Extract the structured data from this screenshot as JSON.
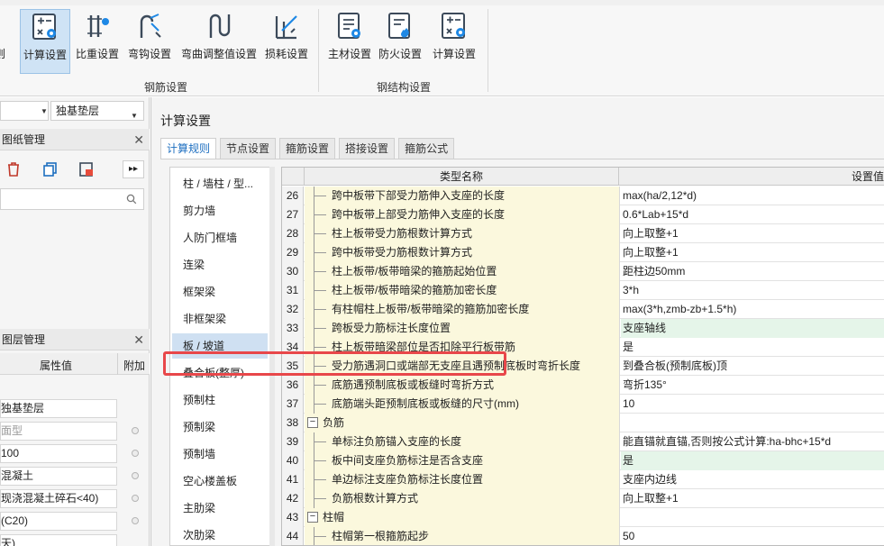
{
  "ribbon": {
    "buttons": [
      {
        "label": "计算设置",
        "icon": "calc-settings-icon",
        "active": true
      },
      {
        "label": "比重设置",
        "icon": "density-icon"
      },
      {
        "label": "弯钩设置",
        "icon": "hook-icon"
      },
      {
        "label": "弯曲调整值设置",
        "icon": "bend-adjust-icon"
      },
      {
        "label": "损耗设置",
        "icon": "loss-icon"
      },
      {
        "label": "主材设置",
        "icon": "main-material-icon"
      },
      {
        "label": "防火设置",
        "icon": "fire-icon"
      },
      {
        "label": "计算设置",
        "icon": "calc-settings-icon"
      }
    ],
    "groups": [
      "钢筋设置",
      "钢结构设置"
    ]
  },
  "left": {
    "layer_select": "独基垫层",
    "drawing_panel_title": "图纸管理",
    "layer_panel_title": "图层管理",
    "attr_col_value": "属性值",
    "attr_col_extra": "附加",
    "attr_values": [
      "独基垫层",
      "面型",
      "100",
      "混凝土",
      "现浇混凝土碎石<40)",
      "(C20)",
      "天)"
    ]
  },
  "dialog": {
    "title": "计算设置",
    "tabs": [
      "计算规则",
      "节点设置",
      "箍筋设置",
      "搭接设置",
      "箍筋公式"
    ],
    "categories": [
      "柱 / 墙柱 / 型...",
      "剪力墙",
      "人防门框墙",
      "连梁",
      "框架梁",
      "非框架梁",
      "板 / 坡道",
      "叠合板(整厚)",
      "预制柱",
      "预制梁",
      "预制墙",
      "空心楼盖板",
      "主肋梁",
      "次肋梁"
    ],
    "selected_category": 6,
    "grid": {
      "col_name": "类型名称",
      "col_value": "设置值",
      "rows": [
        {
          "num": "26",
          "name": "跨中板带下部受力筋伸入支座的长度",
          "value": "max(ha/2,12*d)"
        },
        {
          "num": "27",
          "name": "跨中板带上部受力筋伸入支座的长度",
          "value": "0.6*Lab+15*d"
        },
        {
          "num": "28",
          "name": "柱上板带受力筋根数计算方式",
          "value": "向上取整+1"
        },
        {
          "num": "29",
          "name": "跨中板带受力筋根数计算方式",
          "value": "向上取整+1"
        },
        {
          "num": "30",
          "name": "柱上板带/板带暗梁的箍筋起始位置",
          "value": "距柱边50mm"
        },
        {
          "num": "31",
          "name": "柱上板带/板带暗梁的箍筋加密长度",
          "value": "3*h"
        },
        {
          "num": "32",
          "name": "有柱帽柱上板带/板带暗梁的箍筋加密长度",
          "value": "max(3*h,zmb-zb+1.5*h)"
        },
        {
          "num": "33",
          "name": "跨板受力筋标注长度位置",
          "value": "支座轴线",
          "green": true
        },
        {
          "num": "34",
          "name": "柱上板带暗梁部位是否扣除平行板带筋",
          "value": "是"
        },
        {
          "num": "35",
          "name": "受力筋遇洞口或端部无支座且遇预制底板时弯折长度",
          "value": "到叠合板(预制底板)顶"
        },
        {
          "num": "36",
          "name": "底筋遇预制底板或板缝时弯折方式",
          "value": "弯折135°"
        },
        {
          "num": "37",
          "name": "底筋端头距预制底板或板缝的尺寸(mm)",
          "value": "10"
        },
        {
          "num": "38",
          "name": "负筋",
          "value": "",
          "group": true
        },
        {
          "num": "39",
          "name": "单标注负筋锚入支座的长度",
          "value": "能直锚就直锚,否则按公式计算:ha-bhc+15*d"
        },
        {
          "num": "40",
          "name": "板中间支座负筋标注是否含支座",
          "value": "是",
          "green": true
        },
        {
          "num": "41",
          "name": "单边标注支座负筋标注长度位置",
          "value": "支座内边线"
        },
        {
          "num": "42",
          "name": "负筋根数计算方式",
          "value": "向上取整+1"
        },
        {
          "num": "43",
          "name": "柱帽",
          "value": "",
          "group": true
        },
        {
          "num": "44",
          "name": "柱帽第一根箍筋起步",
          "value": "50"
        }
      ]
    }
  },
  "colors": {
    "accent": "#1e6fc0",
    "highlight": "#e8474a",
    "name_bg": "#fbf8dd",
    "value_green": "#e5f5e9"
  }
}
